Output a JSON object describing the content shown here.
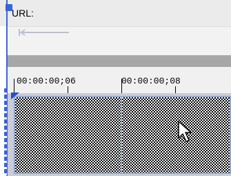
{
  "url_bar": {
    "label": "URL:"
  },
  "ruler": {
    "timecodes": [
      "00:00:00;06",
      "00:00:00;08"
    ]
  },
  "colors": {
    "accent": "#3b63d9",
    "separator": "#a7a7a7",
    "frame_border": "#93a7c9"
  },
  "icons": [
    "flag-icon",
    "left-arrow-icon",
    "playhead-icon",
    "mouse-cursor-icon"
  ]
}
